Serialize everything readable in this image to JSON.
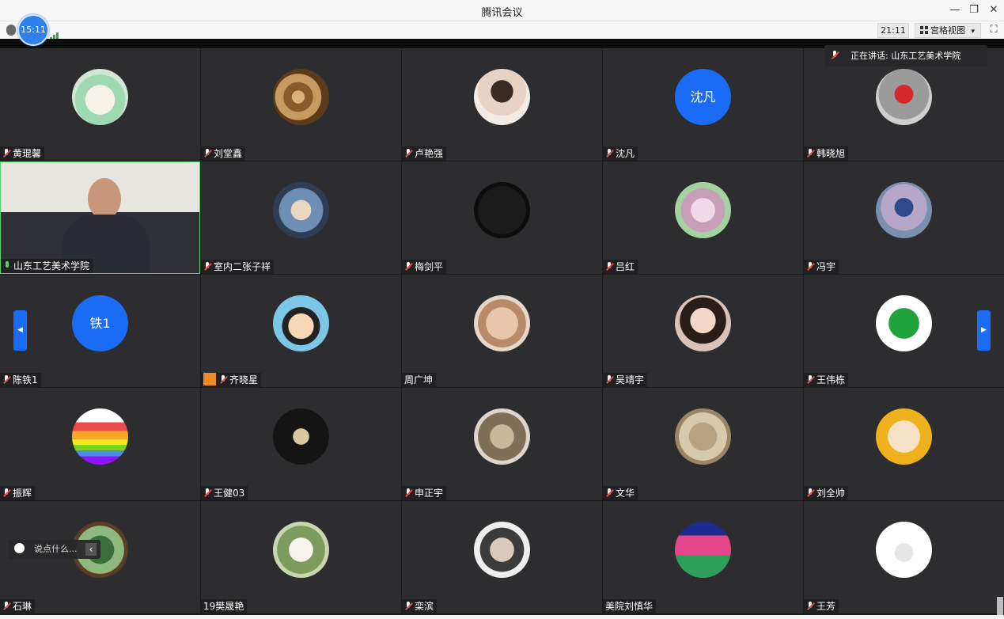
{
  "window": {
    "title": "腾讯会议",
    "controls": [
      "—",
      "❐",
      "✕"
    ]
  },
  "toolbar": {
    "meeting_time": "15:11",
    "clock": "21:11",
    "view_mode": "宫格视图",
    "view_dropdown_icon": "▾",
    "fullscreen_icon": "⛶"
  },
  "speaking": {
    "label": "正在讲话: 山东工艺美术学院"
  },
  "chat": {
    "placeholder": "说点什么...",
    "collapse_icon": "‹"
  },
  "colors": {
    "accent": "#1a6cf6",
    "active_speaker": "#5bd36d",
    "muted": "#e14b4b",
    "tile_bg": "#2d2d30"
  },
  "participants": [
    {
      "name": "黄琨馨",
      "mic": "muted",
      "avatar": "anime-girl-green"
    },
    {
      "name": "刘堂鑫",
      "mic": "muted",
      "avatar": "tree-rings"
    },
    {
      "name": "卢艳强",
      "mic": "muted",
      "avatar": "man-portrait"
    },
    {
      "name": "沈凡",
      "mic": "muted",
      "avatar_text": "沈凡"
    },
    {
      "name": "韩晓旭",
      "mic": "muted",
      "avatar": "child-red-coat"
    },
    {
      "name": "山东工艺美术学院",
      "mic": "on",
      "video": true
    },
    {
      "name": "室内二张子祥",
      "mic": "muted",
      "avatar": "man-reading"
    },
    {
      "name": "梅剑平",
      "mic": "muted",
      "avatar": "dark-night"
    },
    {
      "name": "吕红",
      "mic": "muted",
      "avatar": "flower-shop"
    },
    {
      "name": "冯宇",
      "mic": "muted",
      "avatar": "woman-street"
    },
    {
      "name": "陈铁1",
      "mic": "muted",
      "avatar_text": "铁1"
    },
    {
      "name": "齐晓星",
      "mic": "muted",
      "avatar": "cartoon-girl",
      "badge": "person-icon"
    },
    {
      "name": "周广坤",
      "mic": "none",
      "avatar": "baby"
    },
    {
      "name": "吴靖宇",
      "mic": "muted",
      "avatar": "woman-smiling"
    },
    {
      "name": "王伟栋",
      "mic": "muted",
      "avatar": "green-ball"
    },
    {
      "name": "振辉",
      "mic": "muted",
      "avatar": "rainbow-stack"
    },
    {
      "name": "王健03",
      "mic": "muted",
      "avatar": "gentleman-silhouette"
    },
    {
      "name": "申正宇",
      "mic": "muted",
      "avatar": "street-arches"
    },
    {
      "name": "文华",
      "mic": "muted",
      "avatar": "ink-painting"
    },
    {
      "name": "刘全帅",
      "mic": "muted",
      "avatar": "cartoon-monk"
    },
    {
      "name": "石琳",
      "mic": "muted",
      "avatar": "plants"
    },
    {
      "name": "19樊晟艳",
      "mic": "none",
      "avatar": "woman-white-dress"
    },
    {
      "name": "栾滨",
      "mic": "muted",
      "avatar": "elderly-couple"
    },
    {
      "name": "美院刘慎华",
      "mic": "none",
      "avatar": "pink-tree"
    },
    {
      "name": "王芳",
      "mic": "muted",
      "avatar": "cloud-doodle"
    }
  ]
}
